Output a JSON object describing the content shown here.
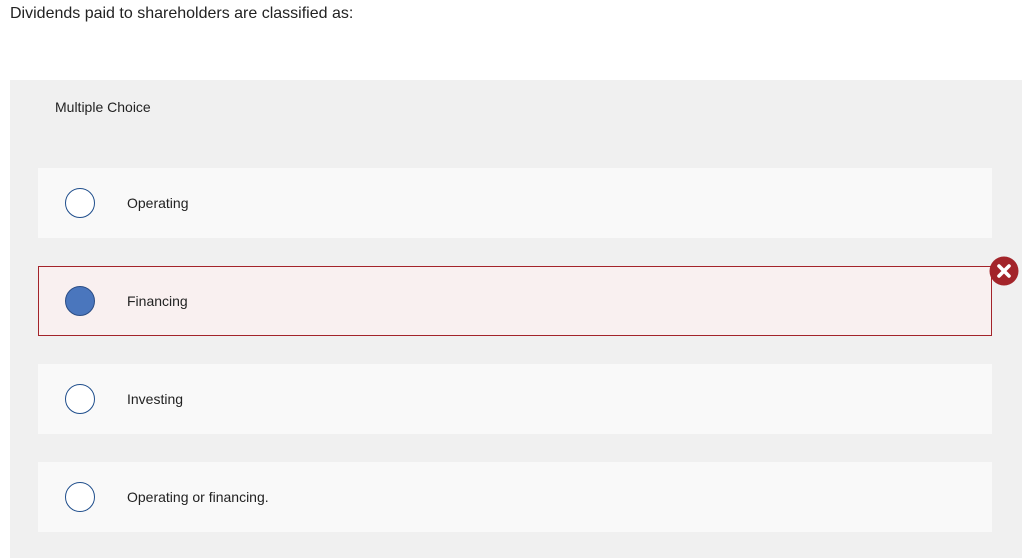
{
  "question": {
    "text": "Dividends paid to shareholders are classified as:"
  },
  "panel": {
    "header_label": "Multiple Choice"
  },
  "options": [
    {
      "label": "Operating",
      "selected": false,
      "status": "none"
    },
    {
      "label": "Financing",
      "selected": true,
      "status": "incorrect"
    },
    {
      "label": "Investing",
      "selected": false,
      "status": "none"
    },
    {
      "label": "Operating or financing.",
      "selected": false,
      "status": "none"
    }
  ],
  "colors": {
    "radio_border": "#1f4e8c",
    "radio_selected_fill": "#4a76bd",
    "incorrect_border": "#a3242a",
    "incorrect_background": "#f9f0f0",
    "incorrect_icon": "#a3242a",
    "panel_background": "#f0f0f0",
    "option_background": "#f9f9f9"
  },
  "icons": {
    "incorrect": "x-circle-icon"
  }
}
